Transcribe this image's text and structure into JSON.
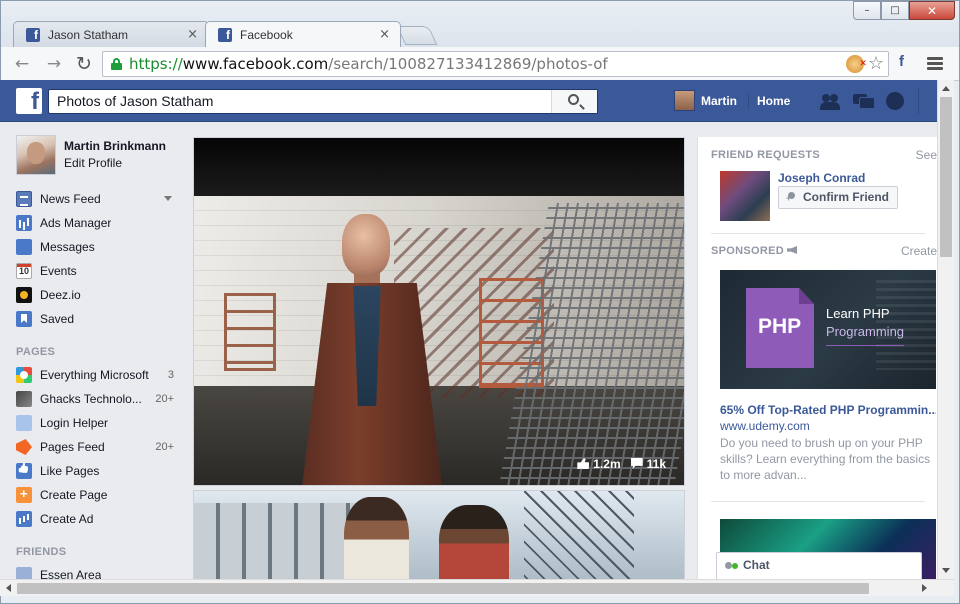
{
  "browser": {
    "tabs": [
      {
        "label": "Jason Statham",
        "close": "×",
        "active": false
      },
      {
        "label": "Facebook",
        "close": "×",
        "active": true
      }
    ],
    "window_controls": {
      "minimize": "–",
      "maximize": "□",
      "close": "✕"
    },
    "nav": {
      "back": "←",
      "forward": "→",
      "reload": "↻"
    },
    "url": {
      "scheme": "https://",
      "host": "www.facebook.com",
      "path": "/search/100827133412869/photos-of"
    },
    "bookmark_star": "☆",
    "extension_fb": "f"
  },
  "fb_header": {
    "logo": "f",
    "search_value": "Photos of Jason Statham",
    "user_name": "Martin",
    "home_label": "Home",
    "color": "#3b5998"
  },
  "left_nav": {
    "profile": {
      "name": "Martin Brinkmann",
      "edit": "Edit Profile"
    },
    "favorites": [
      {
        "label": "News Feed",
        "icon": "news-feed-icon"
      },
      {
        "label": "Ads Manager",
        "icon": "ads-manager-icon"
      },
      {
        "label": "Messages",
        "icon": "messages-icon"
      },
      {
        "label": "Events",
        "icon": "events-icon",
        "badge": "10"
      },
      {
        "label": "Deez.io",
        "icon": "deez-icon"
      },
      {
        "label": "Saved",
        "icon": "saved-icon"
      }
    ],
    "pages_title": "PAGES",
    "pages": [
      {
        "label": "Everything Microsoft",
        "count": "3"
      },
      {
        "label": "Ghacks Technolo...",
        "count": "20+"
      },
      {
        "label": "Login Helper",
        "count": ""
      },
      {
        "label": "Pages Feed",
        "count": "20+"
      },
      {
        "label": "Like Pages",
        "count": ""
      },
      {
        "label": "Create Page",
        "count": ""
      },
      {
        "label": "Create Ad",
        "count": ""
      }
    ],
    "friends_title": "FRIENDS",
    "friends": [
      {
        "label": "Essen Area"
      }
    ]
  },
  "photos": {
    "main": {
      "likes": "1.2m",
      "comments": "11k"
    }
  },
  "right_col": {
    "friend_requests": {
      "title": "FRIEND REQUESTS",
      "see_all": "See",
      "name": "Joseph Conrad",
      "confirm": "Confirm Friend"
    },
    "sponsored": {
      "title": "SPONSORED",
      "create": "Create",
      "ad_image_logo": "PHP",
      "ad_image_line1": "Learn PHP",
      "ad_image_line2": "Programming",
      "ad_title": "65% Off Top-Rated PHP Programmin...",
      "ad_url": "www.udemy.com",
      "ad_desc": "Do you need to brush up on your PHP skills? Learn everything from the basics to more advan..."
    }
  },
  "chat": {
    "label": "Chat",
    "status_color": "#42b72a"
  }
}
